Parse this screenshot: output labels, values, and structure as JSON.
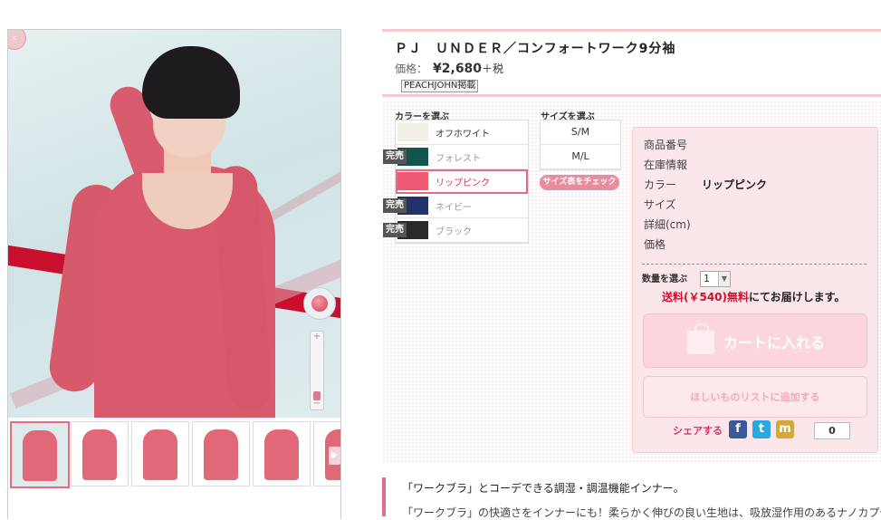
{
  "product": {
    "title": "ＰＪ　ＵＮＤＥＲ／コンフォートワーク9分袖",
    "price_label": "価格：",
    "price_value": "¥2,680",
    "price_tax": "＋税",
    "brand_tag": "PEACHJOHN掲載"
  },
  "gallery": {
    "thumbnail_count": 6,
    "zoom_level_fraction": 0.15
  },
  "color_select": {
    "heading": "カラーを選ぶ",
    "options": [
      {
        "label": "オフホワイト",
        "color": "#f1efe6",
        "sold_out": false,
        "selected": false
      },
      {
        "label": "フォレスト",
        "color": "#13564f",
        "sold_out": true,
        "selected": false
      },
      {
        "label": "リップピンク",
        "color": "#ef5a73",
        "sold_out": false,
        "selected": true
      },
      {
        "label": "ネイビー",
        "color": "#243269",
        "sold_out": true,
        "selected": false
      },
      {
        "label": "ブラック",
        "color": "#2a2a2a",
        "sold_out": true,
        "selected": false
      }
    ],
    "sold_out_label": "完売"
  },
  "size_select": {
    "heading": "サイズを選ぶ",
    "options": [
      "S/M",
      "M/L"
    ],
    "size_chart_button": "サイズ表をチェック"
  },
  "info": {
    "rows": [
      {
        "label": "商品番号",
        "value": ""
      },
      {
        "label": "在庫情報",
        "value": ""
      },
      {
        "label": "カラー",
        "value": "リップピンク"
      },
      {
        "label": "サイズ",
        "value": ""
      },
      {
        "label": "詳細(cm)",
        "value": ""
      },
      {
        "label": "価格",
        "value": ""
      }
    ],
    "quantity_label": "数量を選ぶ",
    "quantity_value": "1",
    "shipping_red": "送料(￥540)無料",
    "shipping_rest": "にてお届けします。",
    "cart_button": "カートに入れる",
    "wishlist_button": "ほしいものリストに追加する",
    "share_label": "シェアする",
    "share_count": "0"
  },
  "description": {
    "title": "「ワークブラ」とコーデできる調湿・調温機能インナー。",
    "body": "「ワークブラ」の快適さをインナーにも！柔らかく伸びの良い生地は、吸放湿作用のあるナノカプセル"
  },
  "colors": {
    "accent_pink": "#e46b82",
    "border_pink": "#f6c9d1",
    "ship_red": "#d0112b",
    "facebook": "#3b5998",
    "twitter": "#2aa9e0",
    "mixi": "#d5a83b"
  }
}
